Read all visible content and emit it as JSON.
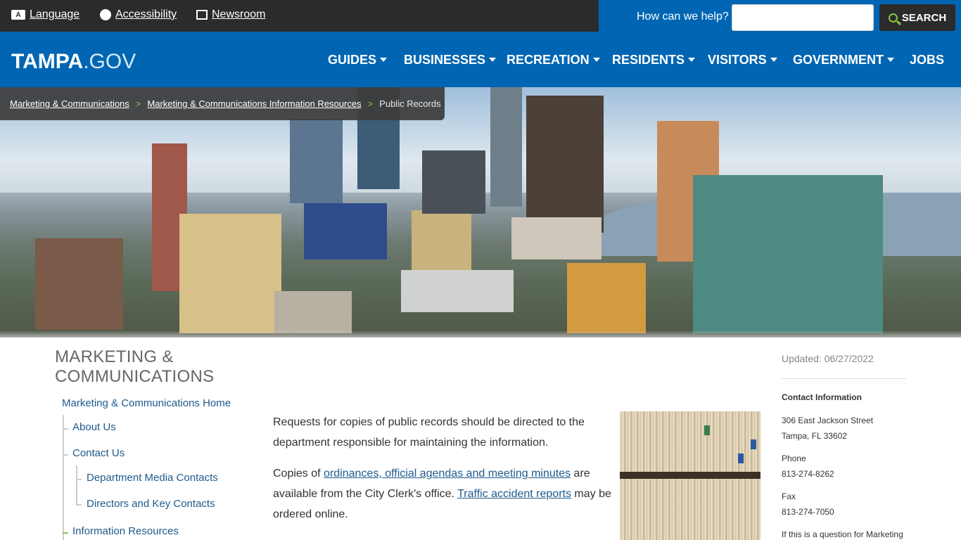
{
  "util": {
    "language": "Language",
    "accessibility": "Accessibility",
    "newsroom": "Newsroom",
    "search_prompt": "How can we help?",
    "search_value": "",
    "search_button": "SEARCH"
  },
  "nav": {
    "logo_strong": "TAMPA",
    "logo_light": ".GOV",
    "items": [
      {
        "label": "GUIDES",
        "has_dropdown": true
      },
      {
        "label": "BUSINESSES",
        "has_dropdown": true
      },
      {
        "label": "RECREATION",
        "has_dropdown": true
      },
      {
        "label": "RESIDENTS",
        "has_dropdown": true
      },
      {
        "label": "VISITORS",
        "has_dropdown": true
      },
      {
        "label": "GOVERNMENT",
        "has_dropdown": true
      },
      {
        "label": "JOBS",
        "has_dropdown": false
      }
    ]
  },
  "breadcrumb": {
    "items": [
      "Marketing & Communications",
      "Marketing & Communications Information Resources"
    ],
    "separator": ">",
    "current": "Public Records"
  },
  "sidebar": {
    "title": "MARKETING & COMMUNICATIONS",
    "home": "Marketing & Communications Home",
    "about": "About Us",
    "contact": "Contact Us",
    "dept_media": "Department Media Contacts",
    "directors": "Directors and Key Contacts",
    "info_resources": "Information Resources"
  },
  "main": {
    "p1": "Requests for copies of public records should be directed to the department responsible for maintaining the information.",
    "p2_a": "Copies of ",
    "p2_link1": "ordinances, official agendas and meeting minutes",
    "p2_b": " are available from the City Clerk's office.  ",
    "p2_link2": "Traffic accident reports",
    "p2_c": " may be ordered online."
  },
  "right": {
    "updated": "Updated: 06/27/2022",
    "contact_heading": "Contact Information",
    "address1": "306 East Jackson Street",
    "address2": "Tampa, FL 33602",
    "phone_label": "Phone",
    "phone": "813-274-8262",
    "fax_label": "Fax",
    "fax": "813-274-7050",
    "note": "If this is a question for Marketing"
  },
  "colors": {
    "brand_blue": "#0066b3",
    "dark": "#2b2b2b",
    "accent_green": "#8cc63f",
    "link": "#1d5a8c"
  }
}
